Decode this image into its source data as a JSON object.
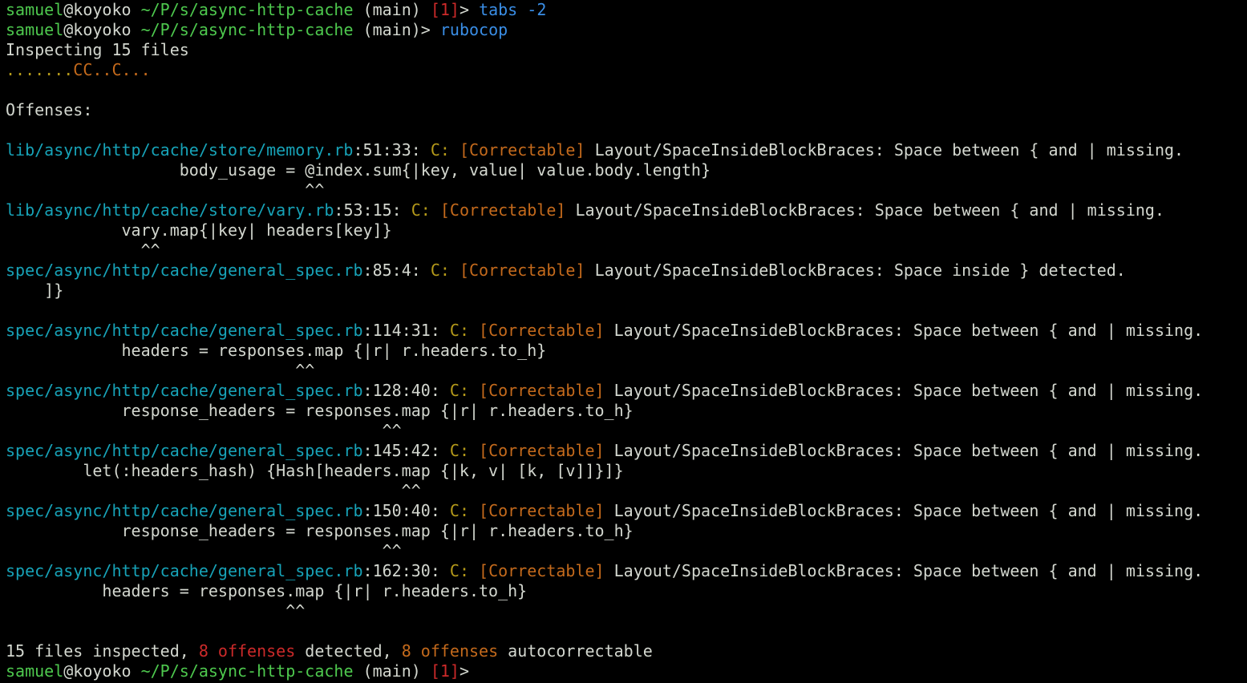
{
  "prompt": {
    "user": "samuel",
    "at": "@",
    "host": "koyoko",
    "path": "~/P/s/async-http-cache",
    "branch": "(main)",
    "status": "[1]",
    "arrow": ">"
  },
  "commands": [
    {
      "cmd": "tabs",
      "arg": "-2"
    },
    {
      "cmd": "rubocop"
    }
  ],
  "inspecting": "Inspecting 15 files",
  "progress_dots": ".......",
  "progress_mid": "CC..C...",
  "offenses_header": "Offenses:",
  "severity": "C:",
  "correctable": "[Correctable]",
  "offenses": [
    {
      "file": "lib/async/http/cache/store/memory.rb",
      "loc": ":51:33:",
      "cop": "Layout/SpaceInsideBlockBraces:",
      "msg": "Space between { and | missing.",
      "code": "                  body_usage = @index.sum{|key, value| value.body.length}",
      "caret": "                               ^^"
    },
    {
      "file": "lib/async/http/cache/store/vary.rb",
      "loc": ":53:15:",
      "cop": "Layout/SpaceInsideBlockBraces:",
      "msg": "Space between { and | missing.",
      "code": "            vary.map{|key| headers[key]}",
      "caret": "              ^^"
    },
    {
      "file": "spec/async/http/cache/general_spec.rb",
      "loc": ":85:4:",
      "cop": "Layout/SpaceInsideBlockBraces:",
      "msg": "Space inside } detected.",
      "code": "    ]}",
      "caret": ""
    },
    {
      "file": "spec/async/http/cache/general_spec.rb",
      "loc": ":114:31:",
      "cop": "Layout/SpaceInsideBlockBraces:",
      "msg": "Space between { and | missing.",
      "code": "            headers = responses.map {|r| r.headers.to_h}",
      "caret": "                              ^^"
    },
    {
      "file": "spec/async/http/cache/general_spec.rb",
      "loc": ":128:40:",
      "cop": "Layout/SpaceInsideBlockBraces:",
      "msg": "Space between { and | missing.",
      "code": "            response_headers = responses.map {|r| r.headers.to_h}",
      "caret": "                                       ^^"
    },
    {
      "file": "spec/async/http/cache/general_spec.rb",
      "loc": ":145:42:",
      "cop": "Layout/SpaceInsideBlockBraces:",
      "msg": "Space between { and | missing.",
      "code": "        let(:headers_hash) {Hash[headers.map {|k, v| [k, [v]]}]}",
      "caret": "                                         ^^"
    },
    {
      "file": "spec/async/http/cache/general_spec.rb",
      "loc": ":150:40:",
      "cop": "Layout/SpaceInsideBlockBraces:",
      "msg": "Space between { and | missing.",
      "code": "            response_headers = responses.map {|r| r.headers.to_h}",
      "caret": "                                       ^^"
    },
    {
      "file": "spec/async/http/cache/general_spec.rb",
      "loc": ":162:30:",
      "cop": "Layout/SpaceInsideBlockBraces:",
      "msg": "Space between { and | missing.",
      "code": "          headers = responses.map {|r| r.headers.to_h}",
      "caret": "                             ^^"
    }
  ],
  "summary": {
    "prefix": "15 files inspected, ",
    "offenses_count": "8 offenses",
    "mid": " detected, ",
    "autocorrect_count": "8 offenses",
    "suffix": " autocorrectable"
  },
  "colors": {
    "user": "#4ec94e",
    "path": "#4ec94e",
    "status": "#cc2a2a",
    "command": "#3a8ee6",
    "file": "#17a3b8",
    "correctable": "#c46a1c",
    "severity": "#b59a1a"
  }
}
